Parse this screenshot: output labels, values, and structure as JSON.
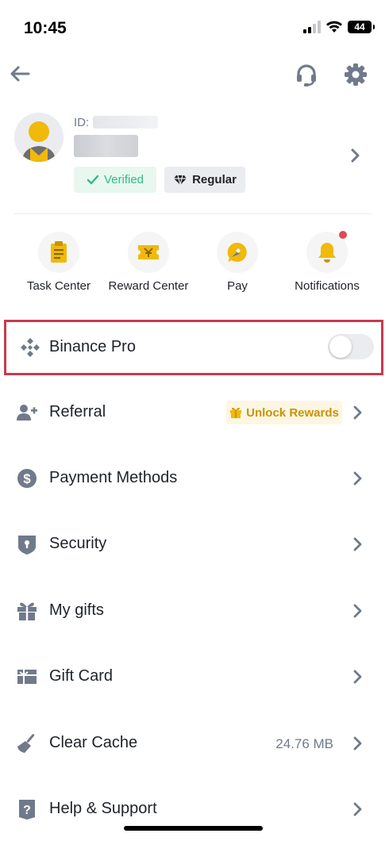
{
  "status_bar": {
    "time": "10:45",
    "battery": "44"
  },
  "profile": {
    "id_label": "ID:",
    "verified_label": "Verified",
    "tier_label": "Regular"
  },
  "shortcuts": [
    {
      "label": "Task Center",
      "icon": "clipboard-icon"
    },
    {
      "label": "Reward Center",
      "icon": "ticket-icon"
    },
    {
      "label": "Pay",
      "icon": "pay-icon"
    },
    {
      "label": "Notifications",
      "icon": "bell-icon",
      "has_unread_dot": true
    }
  ],
  "binance_pro": {
    "label": "Binance Pro",
    "enabled": false
  },
  "menu": [
    {
      "label": "Referral",
      "icon": "add-user-icon",
      "badge": "Unlock Rewards"
    },
    {
      "label": "Payment Methods",
      "icon": "dollar-icon"
    },
    {
      "label": "Security",
      "icon": "shield-icon"
    },
    {
      "label": "My gifts",
      "icon": "gift-icon"
    },
    {
      "label": "Gift Card",
      "icon": "gift-card-icon"
    },
    {
      "label": "Clear Cache",
      "icon": "broom-icon",
      "value": "24.76 MB"
    },
    {
      "label": "Help & Support",
      "icon": "help-icon"
    }
  ],
  "colors": {
    "brand_yellow": "#F0B90B",
    "text_primary": "#1E2329",
    "text_secondary": "#707A8A",
    "verified_green": "#2EBD85",
    "highlight_red": "#C73A4E",
    "icon_gray": "#707A8A"
  }
}
